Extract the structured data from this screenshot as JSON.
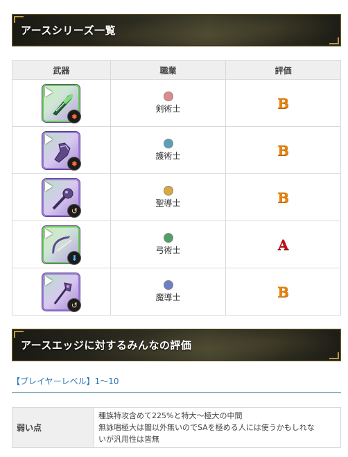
{
  "section1": {
    "title": "アースシリーズ一覧"
  },
  "table": {
    "headers": {
      "weapon": "武器",
      "job": "職業",
      "rating": "評価"
    },
    "rows": [
      {
        "weapon_icon": "spear-weapon-icon",
        "element_icon": "fire-icon",
        "job_icon": "sword-class-icon",
        "job_color": "#e08a8a",
        "job": "剣術士",
        "rating": "B"
      },
      {
        "weapon_icon": "gauntlet-weapon-icon",
        "element_icon": "fire-icon",
        "job_icon": "shield-class-icon",
        "job_color": "#5aa0b8",
        "job": "護術士",
        "rating": "B"
      },
      {
        "weapon_icon": "mace-weapon-icon",
        "element_icon": "swirl-icon",
        "job_icon": "holy-class-icon",
        "job_color": "#d9a93a",
        "job": "聖導士",
        "rating": "B"
      },
      {
        "weapon_icon": "bow-weapon-icon",
        "element_icon": "down-arrow-icon",
        "job_icon": "bow-class-icon",
        "job_color": "#4fa062",
        "job": "弓術士",
        "rating": "A"
      },
      {
        "weapon_icon": "staff-weapon-icon",
        "element_icon": "swirl-icon",
        "job_icon": "magic-class-icon",
        "job_color": "#6a7fc8",
        "job": "魔導士",
        "rating": "B"
      }
    ]
  },
  "section2": {
    "title": "アースエッジに対するみんなの評価"
  },
  "player_level": "【プレイヤーレベル】1〜10",
  "review": {
    "label": "弱い点",
    "lines": [
      "種族特攻含めて225%と特大〜極大の中間",
      "無詠唱極大は闇以外無いのでSAを極める人には使うかもしれな",
      "いが汎用性は皆無"
    ]
  }
}
